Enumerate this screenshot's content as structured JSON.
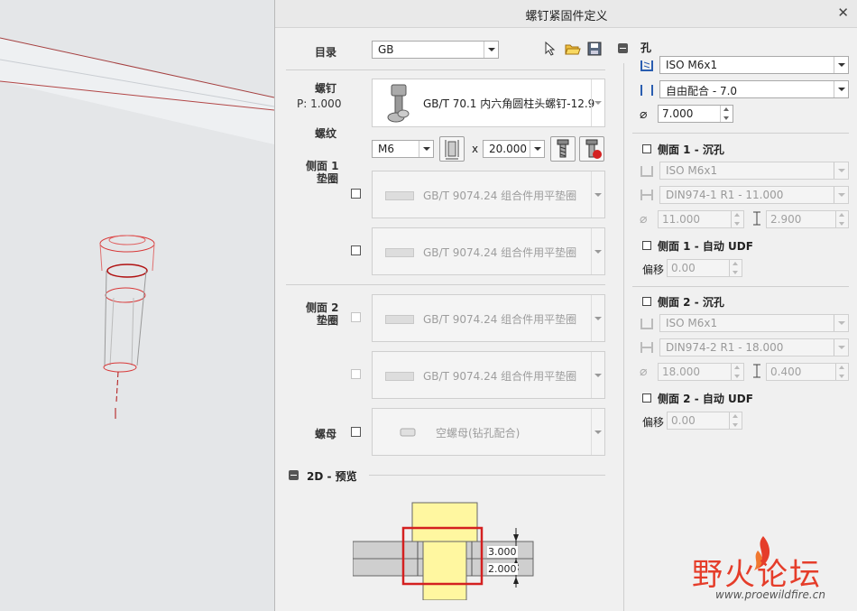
{
  "dialog": {
    "title": "螺钉紧固件定义"
  },
  "catalog": {
    "label": "目录",
    "value": "GB"
  },
  "screw": {
    "label": "螺钉",
    "p_value": "P: 1.000",
    "part": "GB/T 70.1 内六角圆柱头螺钉-12.9"
  },
  "thread": {
    "label": "螺纹",
    "size": "M6",
    "x": "x",
    "length": "20.000"
  },
  "side1_washer": {
    "label_line1": "侧面 1",
    "label_line2": "垫圈",
    "items": [
      "GB/T 9074.24 组合件用平垫圈",
      "GB/T 9074.24 组合件用平垫圈"
    ]
  },
  "side2_washer": {
    "label_line1": "侧面 2",
    "label_line2": "垫圈",
    "items": [
      "GB/T 9074.24 组合件用平垫圈",
      "GB/T 9074.24 组合件用平垫圈"
    ]
  },
  "nut": {
    "label": "螺母",
    "value": "空螺母(钻孔配合)"
  },
  "preview": {
    "label": "2D - 预览",
    "dim1": "3.000",
    "dim2": "2.000"
  },
  "hole": {
    "label": "孔",
    "standard": "ISO M6x1",
    "fit": "自由配合 - 7.0",
    "diameter": "7.000"
  },
  "side1_countersink": {
    "label": "侧面 1 - 沉孔",
    "standard": "ISO M6x1",
    "spec": "DIN974-1 R1 - 11.000",
    "diameter": "11.000",
    "depth": "2.900"
  },
  "side1_udf": {
    "label": "侧面 1 - 自动 UDF",
    "offset_label": "偏移",
    "offset": "0.00"
  },
  "side2_countersink": {
    "label": "侧面 2 - 沉孔",
    "standard": "ISO M6x1",
    "spec": "DIN974-2 R1 - 18.000",
    "diameter": "18.000",
    "depth": "0.400"
  },
  "side2_udf": {
    "label": "侧面 2 - 自动 UDF",
    "offset_label": "偏移",
    "offset": "0.00"
  },
  "watermark": {
    "brand": "野火论坛",
    "url": "www.proewildfire.cn"
  },
  "colors": {
    "accent_red": "#d42020",
    "preview_yellow": "#fff7a0",
    "hole_icon_blue": "#2a5db0"
  }
}
